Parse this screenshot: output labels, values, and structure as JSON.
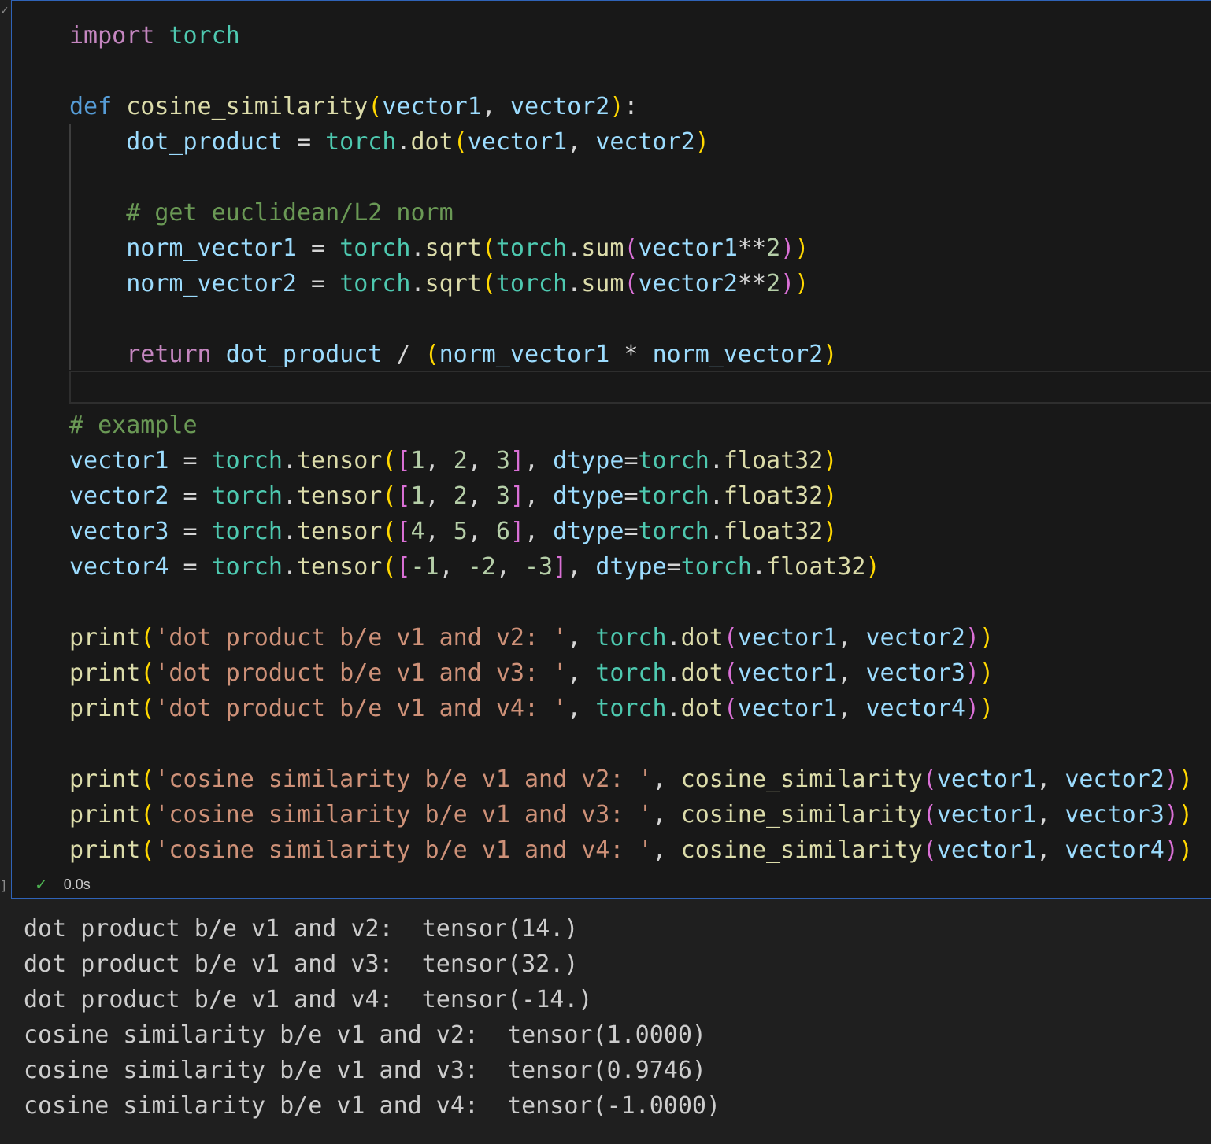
{
  "cell": {
    "code_lines": [
      [
        {
          "t": "import",
          "c": "kw"
        },
        {
          "t": " "
        },
        {
          "t": "torch",
          "c": "mod"
        }
      ],
      [],
      [
        {
          "t": "def",
          "c": "def"
        },
        {
          "t": " "
        },
        {
          "t": "cosine_similarity",
          "c": "fn"
        },
        {
          "t": "(",
          "c": "p1"
        },
        {
          "t": "vector1",
          "c": "var"
        },
        {
          "t": ", "
        },
        {
          "t": "vector2",
          "c": "var"
        },
        {
          "t": ")",
          "c": "p1"
        },
        {
          "t": ":"
        }
      ],
      [
        {
          "t": "    "
        },
        {
          "t": "dot_product",
          "c": "var"
        },
        {
          "t": " = "
        },
        {
          "t": "torch",
          "c": "mod"
        },
        {
          "t": "."
        },
        {
          "t": "dot",
          "c": "fn"
        },
        {
          "t": "(",
          "c": "p1"
        },
        {
          "t": "vector1",
          "c": "var"
        },
        {
          "t": ", "
        },
        {
          "t": "vector2",
          "c": "var"
        },
        {
          "t": ")",
          "c": "p1"
        }
      ],
      [],
      [
        {
          "t": "    "
        },
        {
          "t": "# get euclidean/L2 norm",
          "c": "cm"
        }
      ],
      [
        {
          "t": "    "
        },
        {
          "t": "norm_vector1",
          "c": "var"
        },
        {
          "t": " = "
        },
        {
          "t": "torch",
          "c": "mod"
        },
        {
          "t": "."
        },
        {
          "t": "sqrt",
          "c": "fn"
        },
        {
          "t": "(",
          "c": "p1"
        },
        {
          "t": "torch",
          "c": "mod"
        },
        {
          "t": "."
        },
        {
          "t": "sum",
          "c": "fn"
        },
        {
          "t": "(",
          "c": "p2"
        },
        {
          "t": "vector1",
          "c": "var"
        },
        {
          "t": "**"
        },
        {
          "t": "2",
          "c": "num"
        },
        {
          "t": ")",
          "c": "p2"
        },
        {
          "t": ")",
          "c": "p1"
        }
      ],
      [
        {
          "t": "    "
        },
        {
          "t": "norm_vector2",
          "c": "var"
        },
        {
          "t": " = "
        },
        {
          "t": "torch",
          "c": "mod"
        },
        {
          "t": "."
        },
        {
          "t": "sqrt",
          "c": "fn"
        },
        {
          "t": "(",
          "c": "p1"
        },
        {
          "t": "torch",
          "c": "mod"
        },
        {
          "t": "."
        },
        {
          "t": "sum",
          "c": "fn"
        },
        {
          "t": "(",
          "c": "p2"
        },
        {
          "t": "vector2",
          "c": "var"
        },
        {
          "t": "**"
        },
        {
          "t": "2",
          "c": "num"
        },
        {
          "t": ")",
          "c": "p2"
        },
        {
          "t": ")",
          "c": "p1"
        }
      ],
      [],
      [
        {
          "t": "    "
        },
        {
          "t": "return",
          "c": "kw"
        },
        {
          "t": " "
        },
        {
          "t": "dot_product",
          "c": "var"
        },
        {
          "t": " / "
        },
        {
          "t": "(",
          "c": "p1"
        },
        {
          "t": "norm_vector1",
          "c": "var"
        },
        {
          "t": " * "
        },
        {
          "t": "norm_vector2",
          "c": "var"
        },
        {
          "t": ")",
          "c": "p1"
        }
      ],
      [],
      [
        {
          "t": "# example",
          "c": "cm"
        }
      ],
      [
        {
          "t": "vector1",
          "c": "var"
        },
        {
          "t": " = "
        },
        {
          "t": "torch",
          "c": "mod"
        },
        {
          "t": "."
        },
        {
          "t": "tensor",
          "c": "fn"
        },
        {
          "t": "(",
          "c": "p1"
        },
        {
          "t": "[",
          "c": "p2"
        },
        {
          "t": "1",
          "c": "num"
        },
        {
          "t": ", "
        },
        {
          "t": "2",
          "c": "num"
        },
        {
          "t": ", "
        },
        {
          "t": "3",
          "c": "num"
        },
        {
          "t": "]",
          "c": "p2"
        },
        {
          "t": ", "
        },
        {
          "t": "dtype",
          "c": "var"
        },
        {
          "t": "="
        },
        {
          "t": "torch",
          "c": "mod"
        },
        {
          "t": "."
        },
        {
          "t": "float32",
          "c": "fn"
        },
        {
          "t": ")",
          "c": "p1"
        }
      ],
      [
        {
          "t": "vector2",
          "c": "var"
        },
        {
          "t": " = "
        },
        {
          "t": "torch",
          "c": "mod"
        },
        {
          "t": "."
        },
        {
          "t": "tensor",
          "c": "fn"
        },
        {
          "t": "(",
          "c": "p1"
        },
        {
          "t": "[",
          "c": "p2"
        },
        {
          "t": "1",
          "c": "num"
        },
        {
          "t": ", "
        },
        {
          "t": "2",
          "c": "num"
        },
        {
          "t": ", "
        },
        {
          "t": "3",
          "c": "num"
        },
        {
          "t": "]",
          "c": "p2"
        },
        {
          "t": ", "
        },
        {
          "t": "dtype",
          "c": "var"
        },
        {
          "t": "="
        },
        {
          "t": "torch",
          "c": "mod"
        },
        {
          "t": "."
        },
        {
          "t": "float32",
          "c": "fn"
        },
        {
          "t": ")",
          "c": "p1"
        }
      ],
      [
        {
          "t": "vector3",
          "c": "var"
        },
        {
          "t": " = "
        },
        {
          "t": "torch",
          "c": "mod"
        },
        {
          "t": "."
        },
        {
          "t": "tensor",
          "c": "fn"
        },
        {
          "t": "(",
          "c": "p1"
        },
        {
          "t": "[",
          "c": "p2"
        },
        {
          "t": "4",
          "c": "num"
        },
        {
          "t": ", "
        },
        {
          "t": "5",
          "c": "num"
        },
        {
          "t": ", "
        },
        {
          "t": "6",
          "c": "num"
        },
        {
          "t": "]",
          "c": "p2"
        },
        {
          "t": ", "
        },
        {
          "t": "dtype",
          "c": "var"
        },
        {
          "t": "="
        },
        {
          "t": "torch",
          "c": "mod"
        },
        {
          "t": "."
        },
        {
          "t": "float32",
          "c": "fn"
        },
        {
          "t": ")",
          "c": "p1"
        }
      ],
      [
        {
          "t": "vector4",
          "c": "var"
        },
        {
          "t": " = "
        },
        {
          "t": "torch",
          "c": "mod"
        },
        {
          "t": "."
        },
        {
          "t": "tensor",
          "c": "fn"
        },
        {
          "t": "(",
          "c": "p1"
        },
        {
          "t": "[",
          "c": "p2"
        },
        {
          "t": "-1",
          "c": "num"
        },
        {
          "t": ", "
        },
        {
          "t": "-2",
          "c": "num"
        },
        {
          "t": ", "
        },
        {
          "t": "-3",
          "c": "num"
        },
        {
          "t": "]",
          "c": "p2"
        },
        {
          "t": ", "
        },
        {
          "t": "dtype",
          "c": "var"
        },
        {
          "t": "="
        },
        {
          "t": "torch",
          "c": "mod"
        },
        {
          "t": "."
        },
        {
          "t": "float32",
          "c": "fn"
        },
        {
          "t": ")",
          "c": "p1"
        }
      ],
      [],
      [
        {
          "t": "print",
          "c": "fn"
        },
        {
          "t": "(",
          "c": "p1"
        },
        {
          "t": "'dot product b/e v1 and v2: '",
          "c": "str"
        },
        {
          "t": ", "
        },
        {
          "t": "torch",
          "c": "mod"
        },
        {
          "t": "."
        },
        {
          "t": "dot",
          "c": "fn"
        },
        {
          "t": "(",
          "c": "p2"
        },
        {
          "t": "vector1",
          "c": "var"
        },
        {
          "t": ", "
        },
        {
          "t": "vector2",
          "c": "var"
        },
        {
          "t": ")",
          "c": "p2"
        },
        {
          "t": ")",
          "c": "p1"
        }
      ],
      [
        {
          "t": "print",
          "c": "fn"
        },
        {
          "t": "(",
          "c": "p1"
        },
        {
          "t": "'dot product b/e v1 and v3: '",
          "c": "str"
        },
        {
          "t": ", "
        },
        {
          "t": "torch",
          "c": "mod"
        },
        {
          "t": "."
        },
        {
          "t": "dot",
          "c": "fn"
        },
        {
          "t": "(",
          "c": "p2"
        },
        {
          "t": "vector1",
          "c": "var"
        },
        {
          "t": ", "
        },
        {
          "t": "vector3",
          "c": "var"
        },
        {
          "t": ")",
          "c": "p2"
        },
        {
          "t": ")",
          "c": "p1"
        }
      ],
      [
        {
          "t": "print",
          "c": "fn"
        },
        {
          "t": "(",
          "c": "p1"
        },
        {
          "t": "'dot product b/e v1 and v4: '",
          "c": "str"
        },
        {
          "t": ", "
        },
        {
          "t": "torch",
          "c": "mod"
        },
        {
          "t": "."
        },
        {
          "t": "dot",
          "c": "fn"
        },
        {
          "t": "(",
          "c": "p2"
        },
        {
          "t": "vector1",
          "c": "var"
        },
        {
          "t": ", "
        },
        {
          "t": "vector4",
          "c": "var"
        },
        {
          "t": ")",
          "c": "p2"
        },
        {
          "t": ")",
          "c": "p1"
        }
      ],
      [],
      [
        {
          "t": "print",
          "c": "fn"
        },
        {
          "t": "(",
          "c": "p1"
        },
        {
          "t": "'cosine similarity b/e v1 and v2: '",
          "c": "str"
        },
        {
          "t": ", "
        },
        {
          "t": "cosine_similarity",
          "c": "fn"
        },
        {
          "t": "(",
          "c": "p2"
        },
        {
          "t": "vector1",
          "c": "var"
        },
        {
          "t": ", "
        },
        {
          "t": "vector2",
          "c": "var"
        },
        {
          "t": ")",
          "c": "p2"
        },
        {
          "t": ")",
          "c": "p1"
        }
      ],
      [
        {
          "t": "print",
          "c": "fn"
        },
        {
          "t": "(",
          "c": "p1"
        },
        {
          "t": "'cosine similarity b/e v1 and v3: '",
          "c": "str"
        },
        {
          "t": ", "
        },
        {
          "t": "cosine_similarity",
          "c": "fn"
        },
        {
          "t": "(",
          "c": "p2"
        },
        {
          "t": "vector1",
          "c": "var"
        },
        {
          "t": ", "
        },
        {
          "t": "vector3",
          "c": "var"
        },
        {
          "t": ")",
          "c": "p2"
        },
        {
          "t": ")",
          "c": "p1"
        }
      ],
      [
        {
          "t": "print",
          "c": "fn"
        },
        {
          "t": "(",
          "c": "p1"
        },
        {
          "t": "'cosine similarity b/e v1 and v4: '",
          "c": "str"
        },
        {
          "t": ", "
        },
        {
          "t": "cosine_similarity",
          "c": "fn"
        },
        {
          "t": "(",
          "c": "p2"
        },
        {
          "t": "vector1",
          "c": "var"
        },
        {
          "t": ", "
        },
        {
          "t": "vector4",
          "c": "var"
        },
        {
          "t": ")",
          "c": "p2"
        },
        {
          "t": ")",
          "c": "p1"
        }
      ]
    ],
    "status": {
      "check_glyph": "✓",
      "duration": "0.0s",
      "success_color": "#4caf50"
    }
  },
  "output": {
    "lines": [
      "dot product b/e v1 and v2:  tensor(14.)",
      "dot product b/e v1 and v3:  tensor(32.)",
      "dot product b/e v1 and v4:  tensor(-14.)",
      "cosine similarity b/e v1 and v2:  tensor(1.0000)",
      "cosine similarity b/e v1 and v3:  tensor(0.9746)",
      "cosine similarity b/e v1 and v4:  tensor(-1.0000)"
    ]
  },
  "theme": {
    "editor_bg": "#181818",
    "page_bg": "#1f1f1f",
    "focus_border": "#2f63b8"
  }
}
